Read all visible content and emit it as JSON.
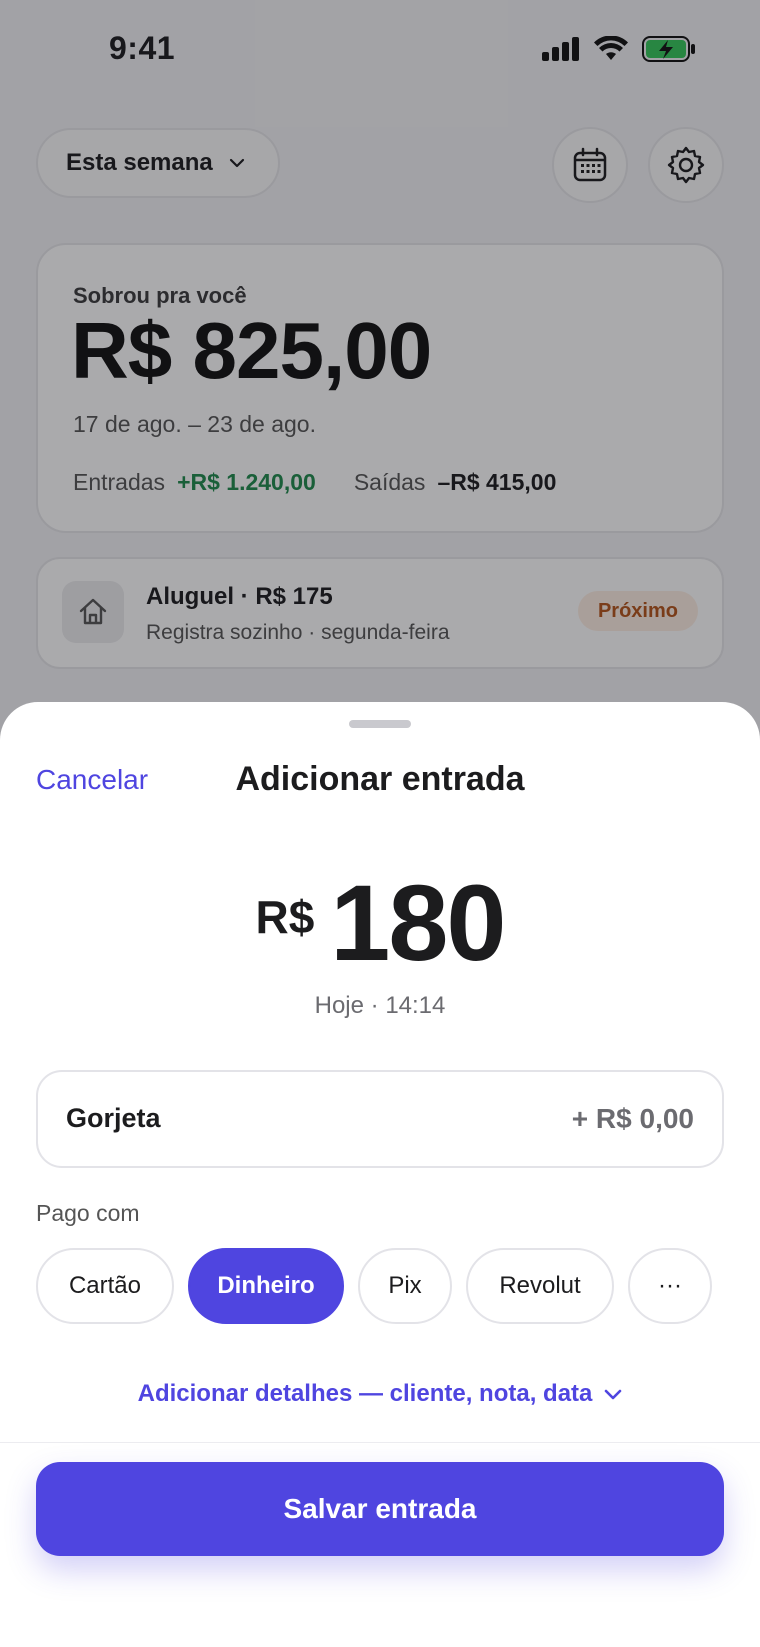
{
  "status_bar": {
    "time": "9:41"
  },
  "header": {
    "period_label": "Esta semana"
  },
  "summary": {
    "label": "Sobrou pra você",
    "amount": "R$ 825,00",
    "range": "17 de ago. – 23 de ago.",
    "income_label": "Entradas",
    "income_value": "+R$ 1.240,00",
    "expense_label": "Saídas",
    "expense_value": "–R$ 415,00",
    "income_color": "#1f8a4c"
  },
  "upcoming": {
    "title": "Aluguel · R$ 175",
    "subtitle": "Registra sozinho · segunda-feira",
    "badge": "Próximo",
    "icon": "home-icon"
  },
  "sheet": {
    "cancel_label": "Cancelar",
    "title": "Adicionar entrada",
    "currency": "R$",
    "amount": "180",
    "timestamp": "Hoje · 14:14",
    "tip_label": "Gorjeta",
    "tip_value": "+ R$ 0,00",
    "paid_with_label": "Pago com",
    "payment_methods": [
      {
        "label": "Cartão",
        "selected": false
      },
      {
        "label": "Dinheiro",
        "selected": true
      },
      {
        "label": "Pix",
        "selected": false
      },
      {
        "label": "Revolut",
        "selected": false
      },
      {
        "label": "···",
        "selected": false
      }
    ],
    "details_link": "Adicionar detalhes — cliente, nota, data",
    "save_label": "Salvar entrada",
    "accent_color": "#4f45e0"
  }
}
